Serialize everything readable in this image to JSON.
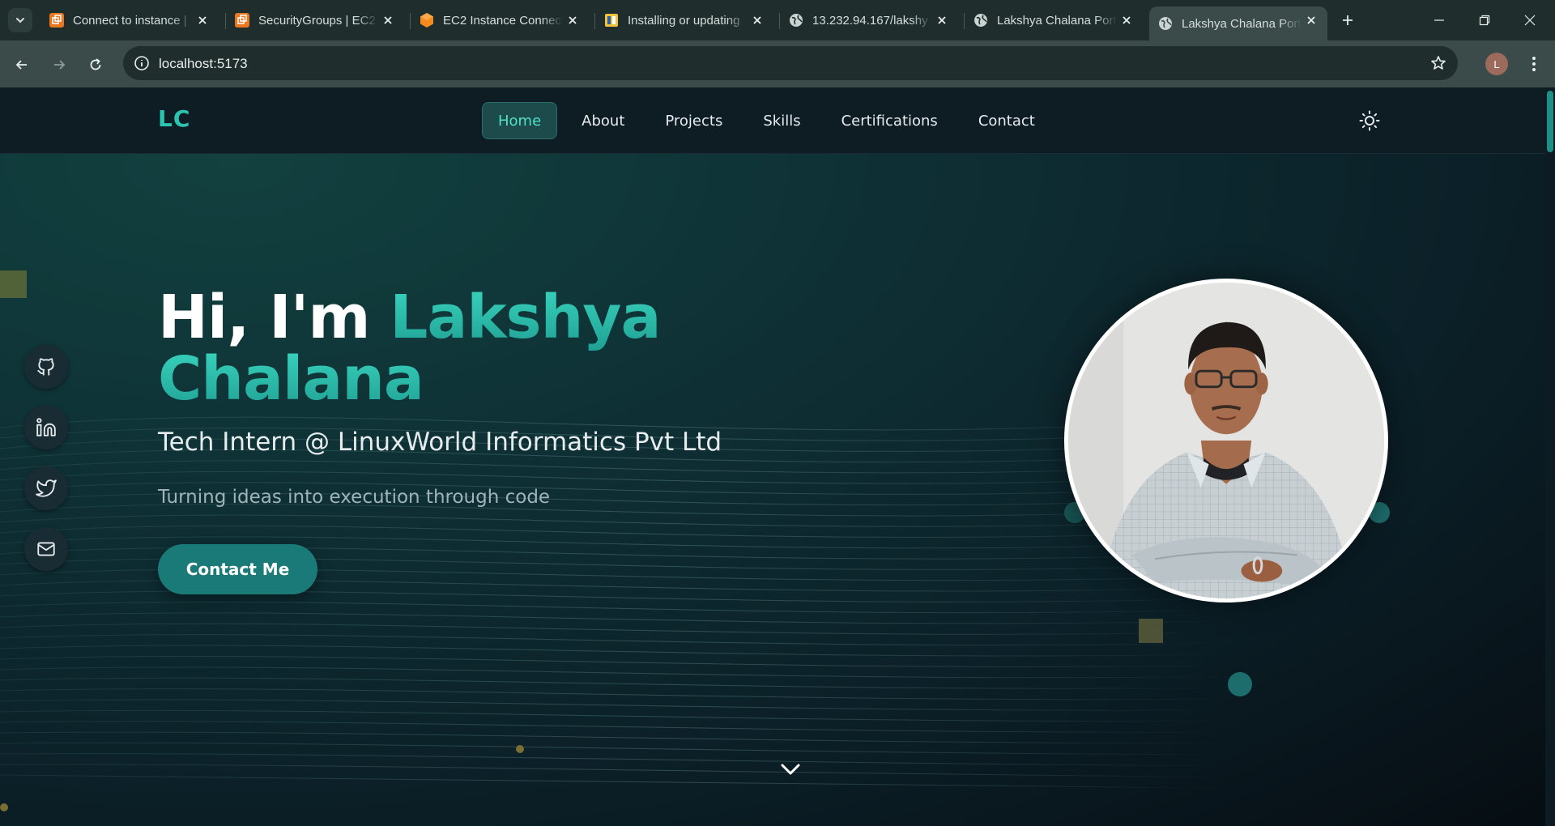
{
  "browser": {
    "tabs": [
      {
        "title": "Connect to instance |",
        "icon": "aws-console-icon",
        "active": false
      },
      {
        "title": "SecurityGroups | EC2",
        "icon": "aws-console-icon",
        "active": false
      },
      {
        "title": "EC2 Instance Connect",
        "icon": "aws-service-icon",
        "active": false
      },
      {
        "title": "Installing or updating",
        "icon": "aws-docs-icon",
        "active": false
      },
      {
        "title": "13.232.94.167/lakshy",
        "icon": "globe-icon",
        "active": false
      },
      {
        "title": "Lakshya Chalana Port",
        "icon": "globe-icon",
        "active": false
      },
      {
        "title": "Lakshya Chalana Port",
        "icon": "globe-icon",
        "active": true
      }
    ],
    "url": "localhost:5173",
    "profile_initial": "L"
  },
  "site": {
    "logo": "LC",
    "nav": [
      {
        "label": "Home",
        "active": true
      },
      {
        "label": "About",
        "active": false
      },
      {
        "label": "Projects",
        "active": false
      },
      {
        "label": "Skills",
        "active": false
      },
      {
        "label": "Certifications",
        "active": false
      },
      {
        "label": "Contact",
        "active": false
      }
    ],
    "socials": [
      "github-icon",
      "linkedin-icon",
      "twitter-icon",
      "mail-icon"
    ]
  },
  "hero": {
    "greeting": "Hi, I'm ",
    "first_name": "Lakshya",
    "last_name": "Chalana",
    "role": "Tech Intern @ LinuxWorld Informatics Pvt Ltd",
    "tagline": "Turning ideas into execution through code",
    "cta_label": "Contact Me"
  },
  "colors": {
    "accent": "#2cc4b0",
    "cta": "#1a7a78",
    "background": "#0b1e26"
  }
}
